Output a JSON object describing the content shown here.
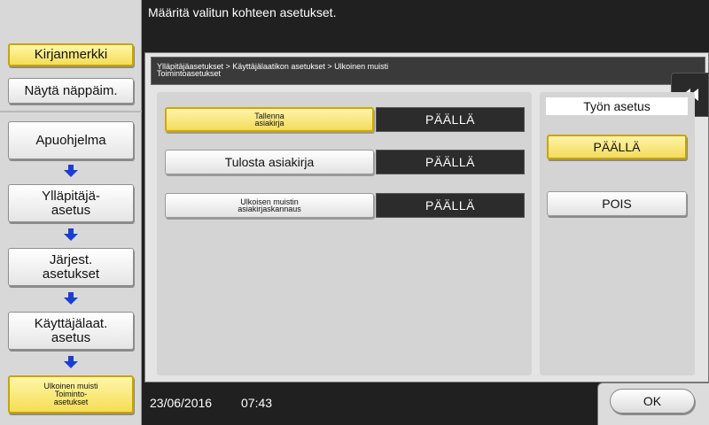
{
  "header": {
    "message": "Määritä valitun kohteen asetukset."
  },
  "sidebar": {
    "bookmark": "Kirjanmerkki",
    "show_keypad": "Näytä näppäim.",
    "nav": [
      {
        "line1": "Apuohjelma",
        "line2": ""
      },
      {
        "line1": "Ylläpitäjä-",
        "line2": "asetus"
      },
      {
        "line1": "Järjest.",
        "line2": "asetukset"
      },
      {
        "line1": "Käyttäjälaat.",
        "line2": "asetus"
      },
      {
        "line1": "Ulkoinen muisti",
        "line2": "Toiminto-",
        "line3": "asetukset"
      }
    ]
  },
  "breadcrumb": {
    "line1": "Ylläpitäjäasetukset > Käyttäjälaatikon asetukset > Ulkoinen muisti",
    "line2": "Toimintoasetukset"
  },
  "functions": [
    {
      "line1": "Tallenna",
      "line2": "asiakirja",
      "value": "PÄÄLLÄ",
      "selected": true
    },
    {
      "line1": "Tulosta asiakirja",
      "line2": "",
      "value": "PÄÄLLÄ",
      "selected": false
    },
    {
      "line1": "Ulkoisen muistin",
      "line2": "asiakirjaskannaus",
      "value": "PÄÄLLÄ",
      "selected": false
    }
  ],
  "job_settings": {
    "title": "Työn asetus",
    "on_label": "PÄÄLLÄ",
    "off_label": "POIS",
    "selected": "PÄÄLLÄ"
  },
  "status": {
    "date": "23/06/2016",
    "time": "07:43"
  },
  "ok_label": "OK",
  "icons": {
    "back": "double-chevron-left-icon",
    "flow_arrow": "arrow-down-icon"
  },
  "colors": {
    "accent_yellow": "#f3dc5c",
    "accent_border": "#c9a400",
    "dark": "#202020",
    "arrow_blue": "#1a3fd0"
  }
}
